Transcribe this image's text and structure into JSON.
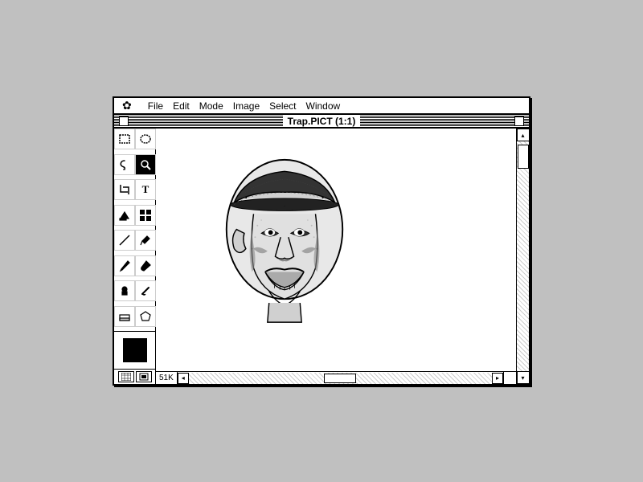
{
  "window": {
    "title": "Trap.PICT (1:1)",
    "close_label": "",
    "zoom_label": ""
  },
  "menu": {
    "apple": "✿",
    "items": [
      "File",
      "Edit",
      "Mode",
      "Image",
      "Select",
      "Window"
    ]
  },
  "tools": [
    {
      "id": "marquee-rect",
      "icon": "rect_select",
      "active": false
    },
    {
      "id": "marquee-oval",
      "icon": "oval_select",
      "active": false
    },
    {
      "id": "lasso",
      "icon": "lasso",
      "active": false
    },
    {
      "id": "magic-wand",
      "icon": "wand",
      "active": false
    },
    {
      "id": "crop",
      "icon": "crop",
      "active": false
    },
    {
      "id": "text",
      "icon": "T",
      "active": false
    },
    {
      "id": "paint-bucket",
      "icon": "bucket",
      "active": false
    },
    {
      "id": "pattern",
      "icon": "pattern",
      "active": false
    },
    {
      "id": "line",
      "icon": "line",
      "active": false
    },
    {
      "id": "eyedropper",
      "icon": "eyedropper",
      "active": false
    },
    {
      "id": "pencil",
      "icon": "pencil",
      "active": false
    },
    {
      "id": "brush",
      "icon": "brush",
      "active": false
    },
    {
      "id": "stamp",
      "icon": "stamp",
      "active": false
    },
    {
      "id": "smudge",
      "icon": "smudge",
      "active": false
    },
    {
      "id": "eraser",
      "icon": "eraser",
      "active": false
    },
    {
      "id": "polygon",
      "icon": "polygon",
      "active": false
    }
  ],
  "color": {
    "foreground": "#000000"
  },
  "status": {
    "file_size": "51K"
  },
  "magnifier": {
    "active": true
  }
}
